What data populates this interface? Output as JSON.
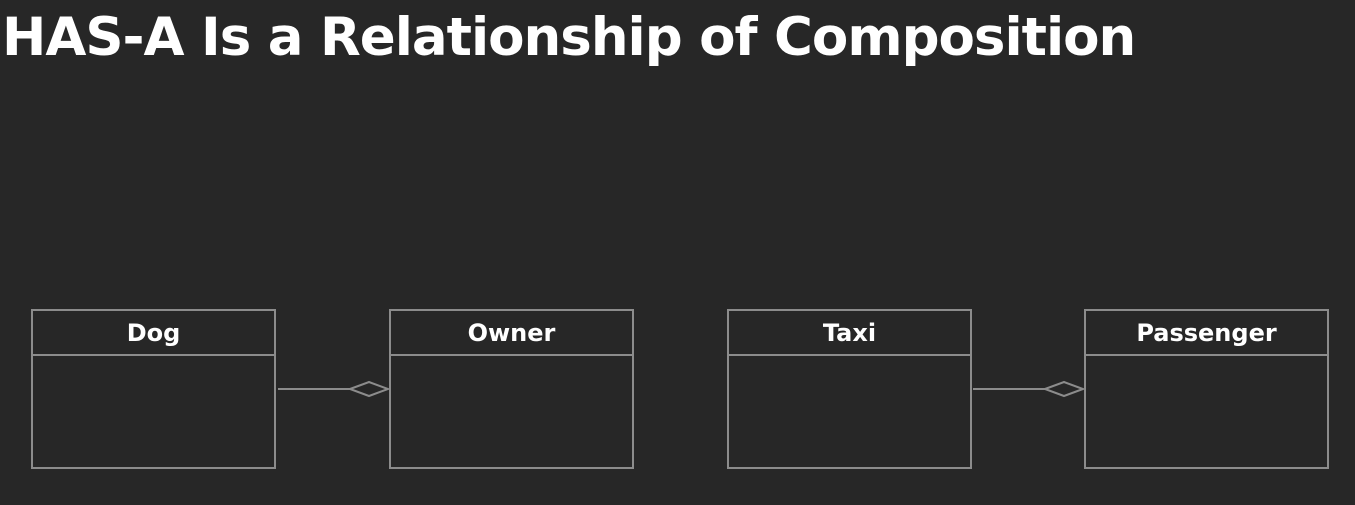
{
  "title": "HAS-A Is a Relationship of Composition",
  "classes": [
    {
      "name": "Dog"
    },
    {
      "name": "Owner"
    },
    {
      "name": "Taxi"
    },
    {
      "name": "Passenger"
    }
  ],
  "relationships": [
    {
      "from": "Dog",
      "to": "Owner",
      "type": "aggregation",
      "end_marker": "hollow-diamond"
    },
    {
      "from": "Taxi",
      "to": "Passenger",
      "type": "aggregation",
      "end_marker": "hollow-diamond"
    }
  ],
  "colors": {
    "background": "#272727",
    "text": "#ffffff",
    "stroke": "#8c8c8c"
  }
}
